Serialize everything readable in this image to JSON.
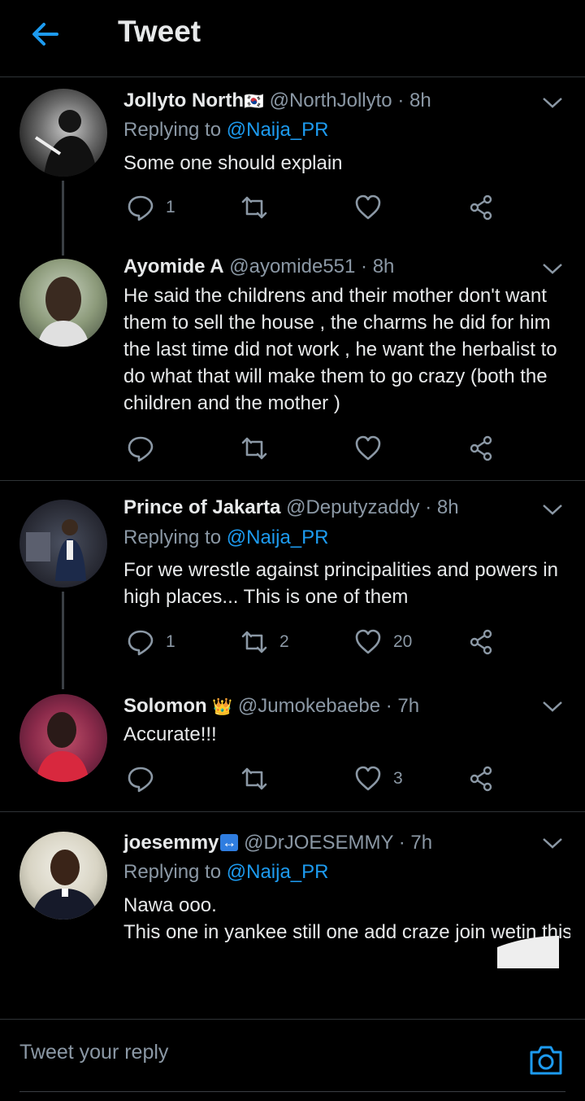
{
  "header": {
    "title": "Tweet"
  },
  "tweets": [
    {
      "name": "Jollyto North",
      "name_flag": "🇰🇷",
      "handle": "@NorthJollyto",
      "time": "· 8h",
      "replying_prefix": "Replying to ",
      "replying_to": "@Naija_PR",
      "text": "Some one should explain",
      "replies": "1",
      "retweets": "",
      "likes": ""
    },
    {
      "name": "Ayomide A",
      "handle": "@ayomide551",
      "time": "· 8h",
      "text": "He said the childrens and their mother don't want them to sell the house , the charms he did for him the last time did not work , he want the herbalist to do what that will make them to go crazy (both the children and the mother )",
      "replies": "",
      "retweets": "",
      "likes": ""
    },
    {
      "name": "Prince of Jakarta",
      "handle": "@Deputyzaddy",
      "time": "· 8h",
      "replying_prefix": "Replying to ",
      "replying_to": "@Naija_PR",
      "text": "For we wrestle against principalities and powers in high places... This is one of them",
      "replies": "1",
      "retweets": "2",
      "likes": "20"
    },
    {
      "name": "Solomon",
      "name_emoji": "👑",
      "handle": "@Jumokebaebe",
      "time": "· 7h",
      "text": "Accurate!!!",
      "replies": "",
      "retweets": "",
      "likes": "3"
    },
    {
      "name": "joesemmy",
      "name_emoji": "↔",
      "handle": "@DrJOESEMMY",
      "time": "· 7h",
      "replying_prefix": "Replying to ",
      "replying_to": "@Naija_PR",
      "text_line1": "Nawa ooo.",
      "text_line2": "This one in yankee still one add craze join wetin this woman and children dey face under b"
    }
  ],
  "composer": {
    "placeholder": "Tweet your reply"
  },
  "colors": {
    "accent": "#1d9bf0",
    "background": "#000000",
    "muted": "#8b98a5",
    "text": "#e7e9ea"
  }
}
